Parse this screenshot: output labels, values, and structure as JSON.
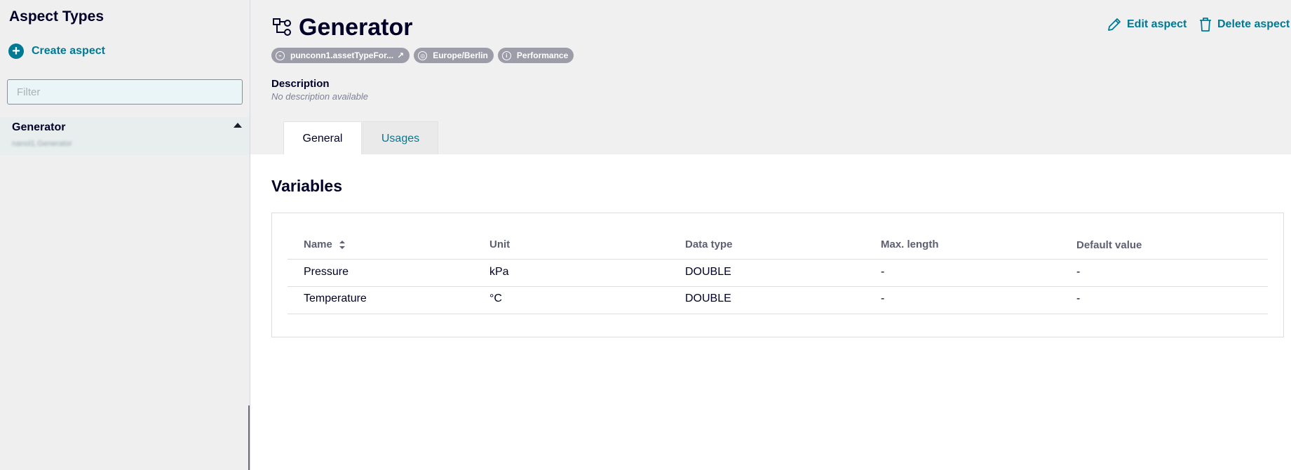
{
  "sidebar": {
    "title": "Aspect Types",
    "create_label": "Create aspect",
    "filter_placeholder": "Filter",
    "items": [
      {
        "title": "Generator",
        "subtitle": "nanol1.Generator"
      }
    ]
  },
  "header": {
    "title": "Generator",
    "badges": [
      {
        "label": "punconn1.assetTypeFor...",
        "icon": "link-icon",
        "external": "↗"
      },
      {
        "label": "Europe/Berlin",
        "icon": "globe-icon"
      },
      {
        "label": "Performance",
        "icon": "info-icon"
      }
    ],
    "description_label": "Description",
    "description_value": "No description available",
    "actions": {
      "edit": "Edit aspect",
      "delete": "Delete aspect"
    },
    "tabs": [
      {
        "label": "General"
      },
      {
        "label": "Usages"
      }
    ]
  },
  "main": {
    "section_title": "Variables",
    "table": {
      "columns": [
        "Name",
        "Unit",
        "Data type",
        "Max. length",
        "Default value"
      ],
      "rows": [
        [
          "Pressure",
          "kPa",
          "DOUBLE",
          "-",
          "-"
        ],
        [
          "Temperature",
          "°C",
          "DOUBLE",
          "-",
          "-"
        ]
      ]
    }
  },
  "colors": {
    "accent": "#007993",
    "text": "#000028",
    "badge": "#9d9da9"
  }
}
